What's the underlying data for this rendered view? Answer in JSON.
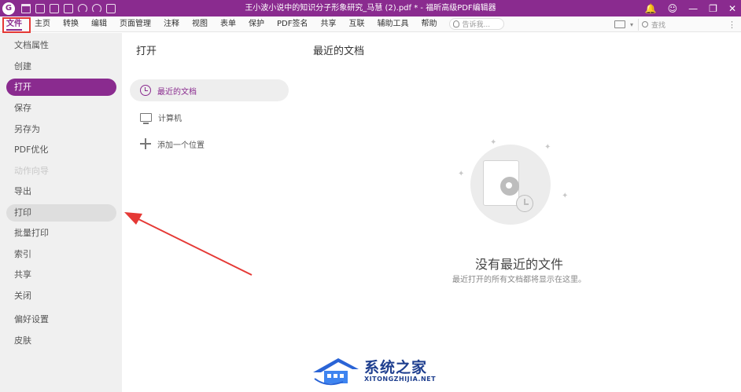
{
  "titlebar": {
    "logo": "G",
    "doc_title": "王小波小说中的知识分子形象研究_马慧 (2).pdf * - 福昕高级PDF编辑器",
    "bell_icon": "🔔",
    "account_icon": "☺",
    "minimize": "—",
    "restore": "❐",
    "close": "✕"
  },
  "menubar": {
    "items": [
      "文件",
      "主页",
      "转换",
      "编辑",
      "页面管理",
      "注释",
      "视图",
      "表单",
      "保护",
      "PDF签名",
      "共享",
      "互联",
      "辅助工具",
      "帮助"
    ],
    "active_index": 0,
    "tellme_placeholder": "告诉我...",
    "search_placeholder": "查找",
    "more": "⋮",
    "chevron": "▾"
  },
  "sidebar": {
    "items": [
      "文档属性",
      "创建",
      "打开",
      "保存",
      "另存为",
      "PDF优化",
      "动作向导",
      "导出",
      "打印",
      "批量打印",
      "索引",
      "共享",
      "关闭",
      "偏好设置",
      "皮肤"
    ],
    "active_index": 2,
    "hover_index": 8,
    "disabled_index": 6
  },
  "open_panel": {
    "title": "打开",
    "locations": [
      "最近的文档",
      "计算机",
      "添加一个位置"
    ]
  },
  "recent": {
    "title": "最近的文档",
    "empty_title": "没有最近的文件",
    "empty_subtitle": "最近打开的所有文档都将显示在这里。"
  },
  "watermark": {
    "name": "系统之家",
    "url": "XITONGZHIJIA.NET"
  },
  "colors": {
    "accent": "#8a2b8f",
    "highlight_box": "#e53935",
    "arrow": "#e53935"
  }
}
